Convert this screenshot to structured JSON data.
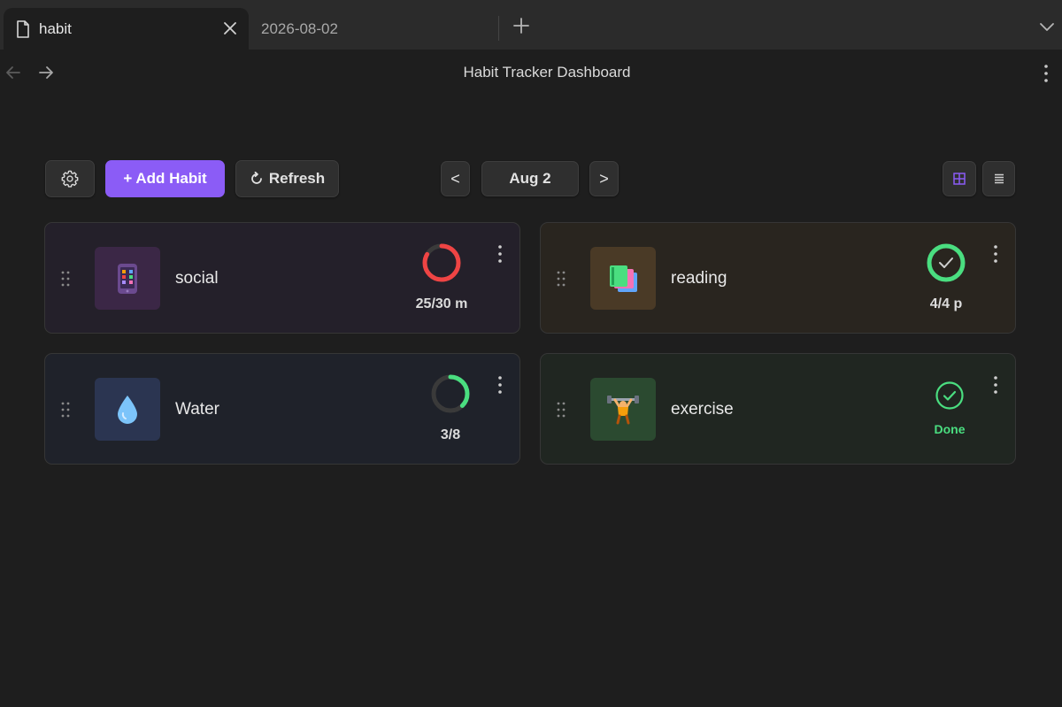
{
  "tabs": [
    {
      "label": "habit",
      "active": true
    },
    {
      "label": "2026-08-02",
      "active": false
    }
  ],
  "header": {
    "title": "Habit Tracker Dashboard"
  },
  "toolbar": {
    "add_habit_label": "+ Add Habit",
    "refresh_label": "Refresh",
    "prev_label": "<",
    "date_label": "Aug 2",
    "next_label": ">"
  },
  "colors": {
    "accent": "#8b5cf6",
    "progress_red": "#ef4444",
    "progress_green": "#4ade80"
  },
  "habits": [
    {
      "name": "social",
      "icon": "mobile-phone-icon",
      "progress_text": "25/30 m",
      "progress": 0.8333,
      "status": "in-progress"
    },
    {
      "name": "reading",
      "icon": "books-icon",
      "progress_text": "4/4 p",
      "progress": 1.0,
      "status": "complete"
    },
    {
      "name": "Water",
      "icon": "droplet-icon",
      "progress_text": "3/8",
      "progress": 0.375,
      "status": "in-progress"
    },
    {
      "name": "exercise",
      "icon": "weightlifter-icon",
      "progress_text": "Done",
      "progress": 1.0,
      "status": "done"
    }
  ]
}
